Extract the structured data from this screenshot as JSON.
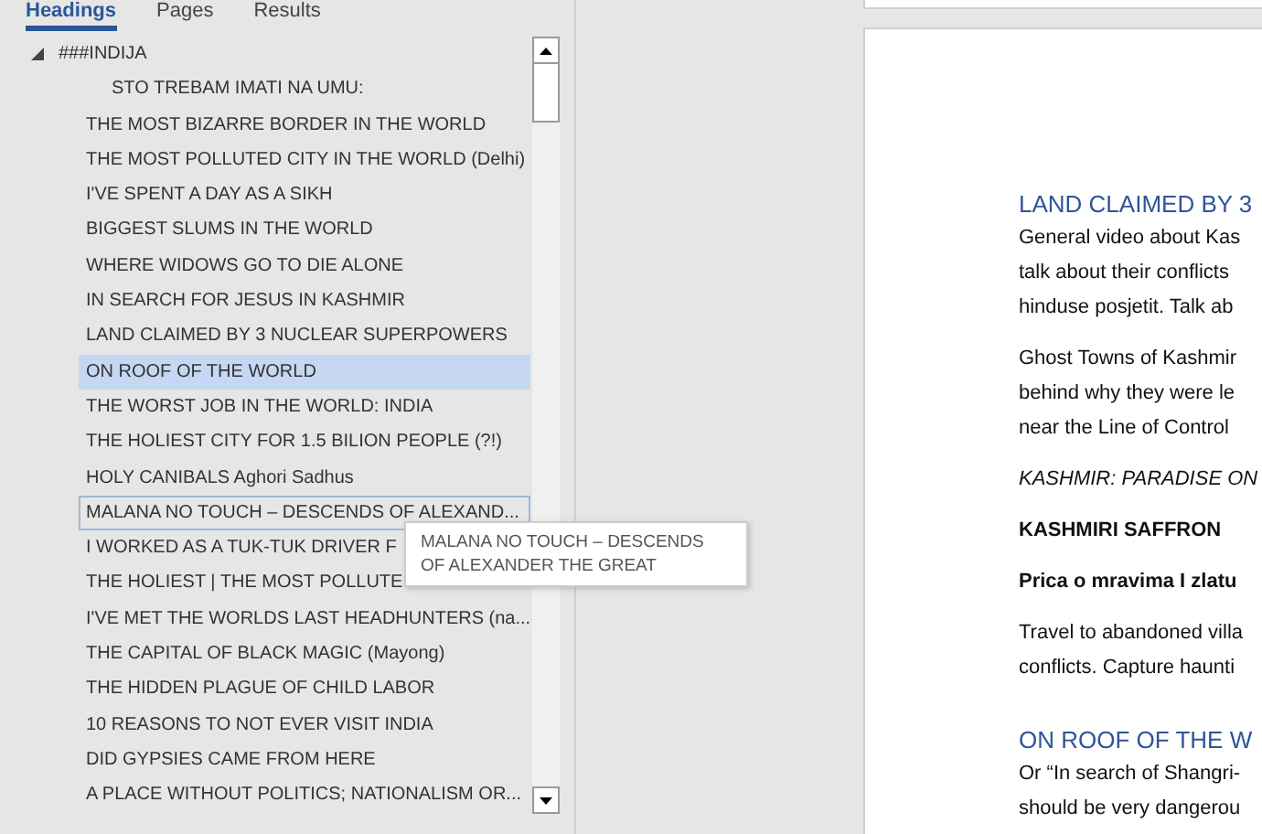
{
  "nav_pane": {
    "tabs": [
      {
        "label": "Headings",
        "selected": true
      },
      {
        "label": "Pages",
        "selected": false
      },
      {
        "label": "Results",
        "selected": false
      }
    ],
    "tree": [
      {
        "label": "###INDIJA",
        "expanded": true,
        "selected": false,
        "hovered": false,
        "children": [
          {
            "label": "STO TREBAM IMATI NA UMU:",
            "kind": "sub",
            "selected": false,
            "hovered": false
          },
          {
            "label": "THE MOST BIZARRE BORDER IN THE WORLD",
            "kind": "main",
            "selected": false,
            "hovered": false
          },
          {
            "label": "THE MOST POLLUTED CITY IN THE WORLD (Delhi)",
            "kind": "main",
            "selected": false,
            "hovered": false
          },
          {
            "label": "I'VE SPENT A DAY AS A SIKH",
            "kind": "main",
            "selected": false,
            "hovered": false
          },
          {
            "label": "BIGGEST SLUMS IN THE WORLD",
            "kind": "main",
            "selected": false,
            "hovered": false
          },
          {
            "label": "WHERE WIDOWS GO TO DIE ALONE",
            "kind": "main",
            "selected": false,
            "hovered": false
          },
          {
            "label": "IN SEARCH FOR JESUS IN KASHMIR",
            "kind": "main",
            "selected": false,
            "hovered": false
          },
          {
            "label": "LAND CLAIMED BY 3 NUCLEAR SUPERPOWERS",
            "kind": "main",
            "selected": false,
            "hovered": false
          },
          {
            "label": "ON ROOF OF THE WORLD",
            "kind": "main",
            "selected": true,
            "hovered": false
          },
          {
            "label": "THE WORST JOB IN THE WORLD: INDIA",
            "kind": "main",
            "selected": false,
            "hovered": false
          },
          {
            "label": "THE HOLIEST CITY FOR 1.5 BILION PEOPLE (?!)",
            "kind": "main",
            "selected": false,
            "hovered": false
          },
          {
            "label": "HOLY CANIBALS Aghori Sadhus",
            "kind": "main",
            "selected": false,
            "hovered": false
          },
          {
            "label": "MALANA NO TOUCH – DESCENDS OF ALEXAND...",
            "kind": "main",
            "selected": false,
            "hovered": true
          },
          {
            "label": "I WORKED AS A TUK-TUK DRIVER F",
            "kind": "main",
            "selected": false,
            "hovered": false
          },
          {
            "label": "THE HOLIEST | THE MOST POLLUTE",
            "kind": "main",
            "selected": false,
            "hovered": false
          },
          {
            "label": "I'VE MET THE WORLDS LAST HEADHUNTERS (na...",
            "kind": "main",
            "selected": false,
            "hovered": false
          },
          {
            "label": "THE CAPITAL OF BLACK MAGIC (Mayong)",
            "kind": "main",
            "selected": false,
            "hovered": false
          },
          {
            "label": "THE HIDDEN PLAGUE OF CHILD LABOR",
            "kind": "main",
            "selected": false,
            "hovered": false
          },
          {
            "label": "10 REASONS TO NOT EVER VISIT INDIA",
            "kind": "main",
            "selected": false,
            "hovered": false
          },
          {
            "label": "DID GYPSIES CAME FROM HERE",
            "kind": "main",
            "selected": false,
            "hovered": false
          },
          {
            "label": "A PLACE WITHOUT POLITICS; NATIONALISM OR...",
            "kind": "main",
            "selected": false,
            "hovered": false
          }
        ]
      }
    ],
    "tooltip": "MALANA NO TOUCH – DESCENDS OF ALEXANDER THE GREAT"
  },
  "document": {
    "blocks": [
      {
        "kind": "heading",
        "lines": [
          "LAND CLAIMED BY 3"
        ]
      },
      {
        "kind": "body",
        "lines": [
          "General video about Kas",
          "talk about their conflicts",
          "hinduse posjetit. Talk ab"
        ]
      },
      {
        "kind": "body",
        "lines": [
          "Ghost Towns of Kashmir",
          "behind why they were le",
          "near the Line of Control"
        ]
      },
      {
        "kind": "italic",
        "lines": [
          "KASHMIR: PARADISE ON"
        ]
      },
      {
        "kind": "bold",
        "lines": [
          "KASHMIRI SAFFRON"
        ]
      },
      {
        "kind": "bold",
        "lines": [
          "Prica o mravima I zlatu"
        ]
      },
      {
        "kind": "body",
        "lines": [
          "Travel to abandoned villa",
          "conflicts. Capture haunti"
        ]
      },
      {
        "kind": "heading",
        "lines": [
          "ON ROOF OF THE W"
        ]
      },
      {
        "kind": "body",
        "lines": [
          "Or “In search of Shangri-",
          "should be very dangerou"
        ]
      }
    ]
  }
}
